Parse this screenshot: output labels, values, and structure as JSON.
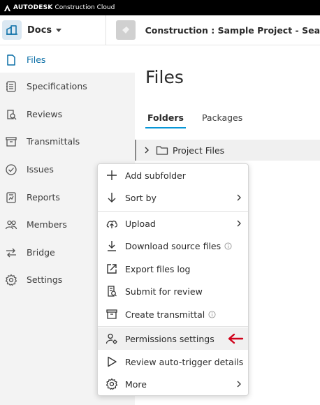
{
  "topbar": {
    "brand": "AUTODESK",
    "product": "Construction Cloud"
  },
  "header": {
    "app_name": "Docs",
    "project_name": "Construction : Sample Project - Sea"
  },
  "sidebar": {
    "items": [
      {
        "label": "Files",
        "icon": "file-icon",
        "active": true
      },
      {
        "label": "Specifications",
        "icon": "specifications-icon"
      },
      {
        "label": "Reviews",
        "icon": "reviews-icon"
      },
      {
        "label": "Transmittals",
        "icon": "transmittals-icon"
      },
      {
        "label": "Issues",
        "icon": "issues-icon"
      },
      {
        "label": "Reports",
        "icon": "reports-icon"
      },
      {
        "label": "Members",
        "icon": "members-icon"
      },
      {
        "label": "Bridge",
        "icon": "bridge-icon"
      },
      {
        "label": "Settings",
        "icon": "settings-icon"
      }
    ]
  },
  "main": {
    "title": "Files",
    "tabs": [
      {
        "label": "Folders",
        "active": true
      },
      {
        "label": "Packages"
      }
    ],
    "folder": {
      "name": "Project Files"
    }
  },
  "context_menu": {
    "items": [
      {
        "label": "Add subfolder",
        "icon": "plus-icon"
      },
      {
        "label": "Sort by",
        "icon": "arrow-down-icon",
        "submenu": true
      },
      {
        "label": "Upload",
        "icon": "cloud-upload-icon",
        "submenu": true
      },
      {
        "label": "Download source files",
        "icon": "download-icon",
        "info": true
      },
      {
        "label": "Export files log",
        "icon": "export-icon"
      },
      {
        "label": "Submit for review",
        "icon": "submit-review-icon"
      },
      {
        "label": "Create transmittal",
        "icon": "transmittal-icon",
        "info": true
      },
      {
        "label": "Permissions settings",
        "icon": "user-gear-icon",
        "highlighted": true
      },
      {
        "label": "Review auto-trigger details",
        "icon": "play-icon"
      },
      {
        "label": "More",
        "icon": "gear-icon",
        "submenu": true
      }
    ]
  },
  "colors": {
    "accent": "#0696d7",
    "active_text": "#0a6ea6",
    "annotation_arrow": "#d0021b",
    "sidebar_bg": "#f3f3f3"
  }
}
